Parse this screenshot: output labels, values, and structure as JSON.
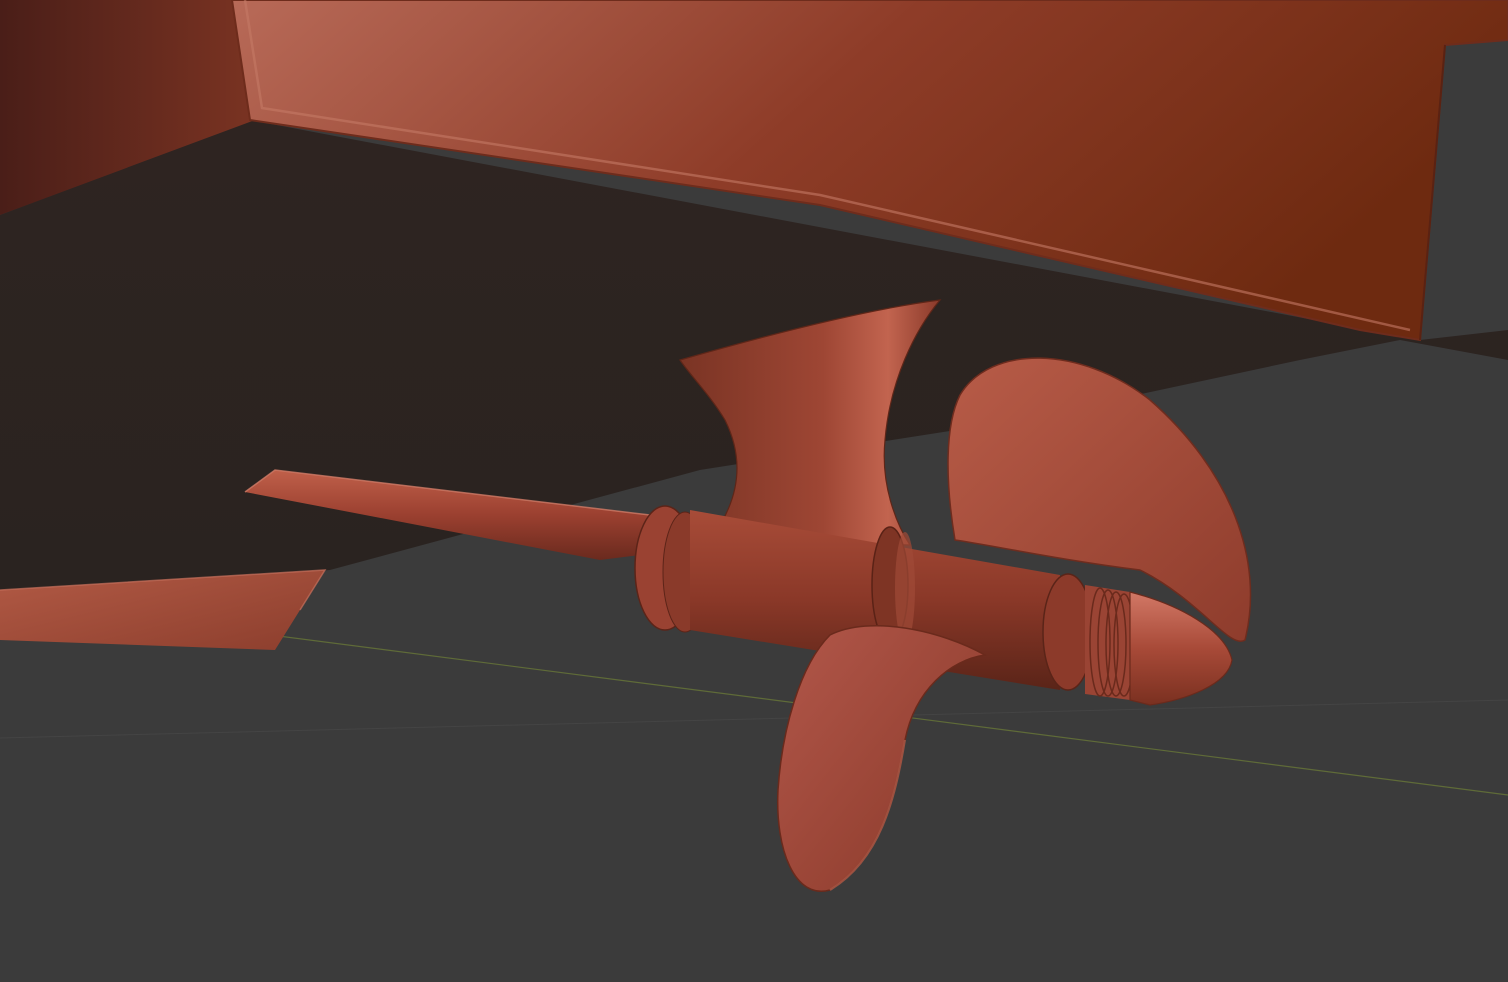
{
  "viewport": {
    "kind": "3d-viewport",
    "shading": "solid",
    "background_color": "#3a3a3a",
    "object_color": "#a0442f",
    "grid_x_axis_color": "#6b7a3a"
  },
  "scene": {
    "objects": [
      {
        "name": "hull",
        "icon": "hull-shape"
      },
      {
        "name": "transom",
        "icon": "transom-panel"
      },
      {
        "name": "propeller-shaft",
        "icon": "shaft"
      },
      {
        "name": "shaft-bracket",
        "icon": "strut"
      },
      {
        "name": "propeller-hub",
        "icon": "hub"
      },
      {
        "name": "propeller-blade-upper",
        "icon": "blade"
      },
      {
        "name": "propeller-blade-lower",
        "icon": "blade"
      },
      {
        "name": "propeller-nose-cone",
        "icon": "cone"
      }
    ]
  }
}
